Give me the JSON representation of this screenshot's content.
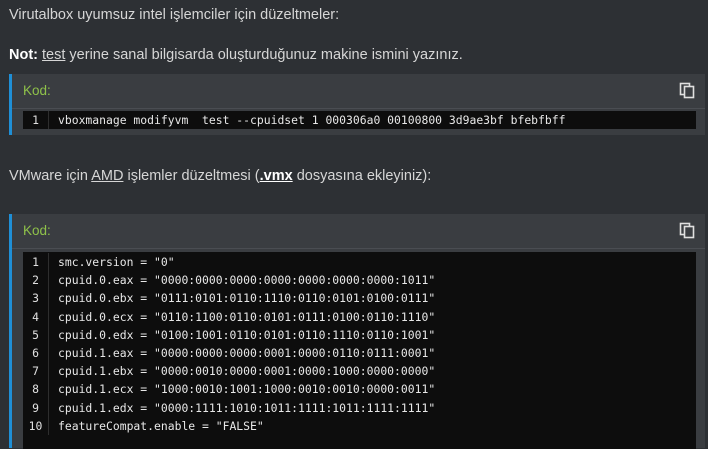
{
  "intro": {
    "heading": "Virutalbox uyumsuz intel işlemciler için düzeltmeler:",
    "note_bold": "Not:",
    "note_link": "test",
    "note_rest": " yerine sanal bilgisarda oluşturduğunuz makine ismini yazınız."
  },
  "code1": {
    "label": "Kod:",
    "lines": [
      {
        "n": "1",
        "text": "vboxmanage modifyvm  test --cpuidset 1 000306a0 00100800 3d9ae3bf bfebfbff"
      }
    ]
  },
  "vmware": {
    "pre": "VMware için ",
    "amd": "AMD",
    "mid": " işlemler düzeltmesi (",
    "vmx": ".vmx",
    "post": " dosyasına ekleyiniz):"
  },
  "code2": {
    "label": "Kod:",
    "lines": [
      {
        "n": "1",
        "text": "smc.version = \"0\""
      },
      {
        "n": "2",
        "text": "cpuid.0.eax = \"0000:0000:0000:0000:0000:0000:0000:1011\""
      },
      {
        "n": "3",
        "text": "cpuid.0.ebx = \"0111:0101:0110:1110:0110:0101:0100:0111\""
      },
      {
        "n": "4",
        "text": "cpuid.0.ecx = \"0110:1100:0110:0101:0111:0100:0110:1110\""
      },
      {
        "n": "5",
        "text": "cpuid.0.edx = \"0100:1001:0110:0101:0110:1110:0110:1001\""
      },
      {
        "n": "6",
        "text": "cpuid.1.eax = \"0000:0000:0000:0001:0000:0110:0111:0001\""
      },
      {
        "n": "7",
        "text": "cpuid.1.ebx = \"0000:0010:0000:0001:0000:1000:0000:0000\""
      },
      {
        "n": "8",
        "text": "cpuid.1.ecx = \"1000:0010:1001:1000:0010:0010:0000:0011\""
      },
      {
        "n": "9",
        "text": "cpuid.1.edx = \"0000:1111:1010:1011:1111:1011:1111:1111\""
      },
      {
        "n": "10",
        "text": "featureCompat.enable = \"FALSE\""
      }
    ]
  },
  "icons": {
    "copy": "copy-icon"
  },
  "colors": {
    "accent_border": "#1f8fd6",
    "code_label": "#8fc24a",
    "code_bg": "#0d0d0d",
    "page_bg": "#2d3034"
  }
}
